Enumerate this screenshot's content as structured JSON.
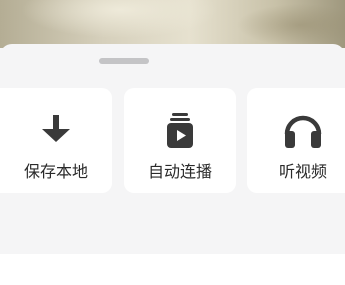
{
  "sheet": {
    "actions": [
      {
        "label": "保存本地",
        "icon": "download-arrow-icon"
      },
      {
        "label": "自动连播",
        "icon": "playlist-play-icon"
      },
      {
        "label": "听视频",
        "icon": "headphones-icon"
      }
    ]
  },
  "colors": {
    "icon": "#3a3a3a",
    "card": "#ffffff",
    "sheet_background": "#f5f5f6"
  }
}
